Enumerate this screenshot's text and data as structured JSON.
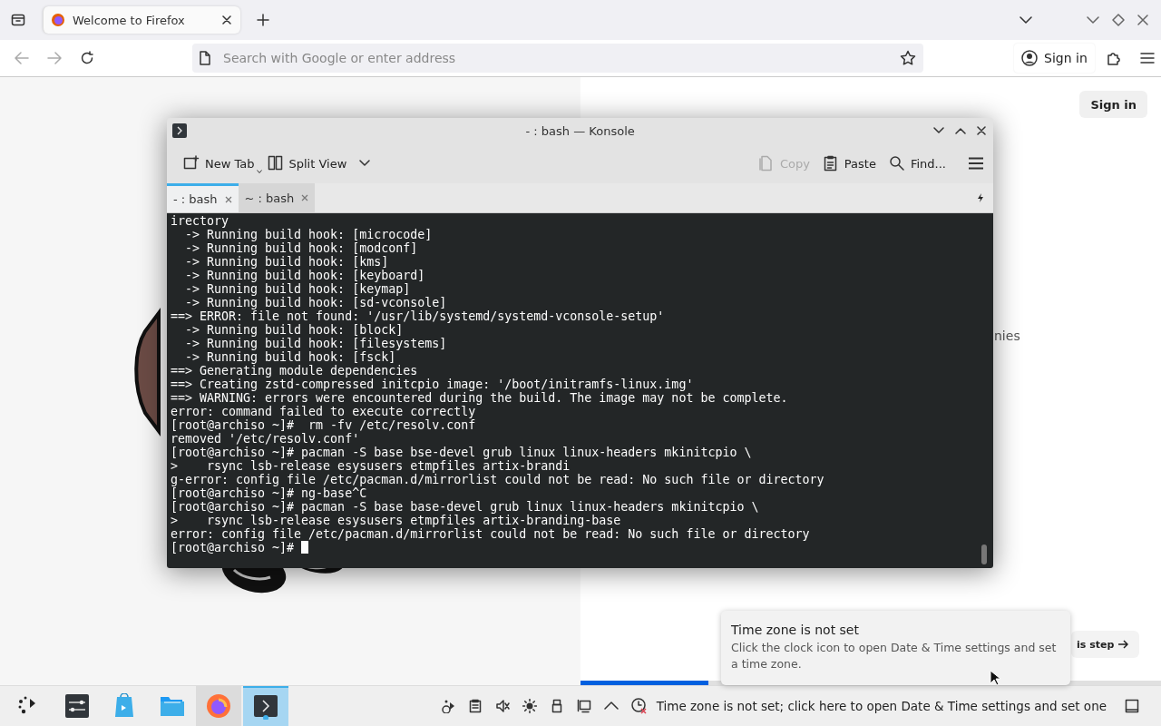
{
  "browser": {
    "tabs": [
      {
        "title": "Welcome to Firefox",
        "selected": true
      }
    ],
    "address_bar": {
      "placeholder": "Search with Google or enter address"
    },
    "sign_in_button": "Sign in"
  },
  "page": {
    "sign_in_button": "Sign in",
    "text_fragment": "nies",
    "skip_button": "is step",
    "progress": {
      "level": 0.22
    }
  },
  "konsole": {
    "title": "- : bash — Konsole",
    "toolbar": [
      {
        "kind": "newtab",
        "label": "New Tab",
        "disabled": false
      },
      {
        "kind": "split",
        "label": "Split View",
        "disabled": false
      },
      {
        "kind": "copy",
        "label": "Copy",
        "disabled": true
      },
      {
        "kind": "paste",
        "label": "Paste",
        "disabled": false
      },
      {
        "kind": "find",
        "label": "Find...",
        "disabled": false
      }
    ],
    "tabs": [
      {
        "title": "- : bash",
        "selected": true
      },
      {
        "title": "~ : bash",
        "selected": false
      }
    ],
    "lines": [
      "irectory",
      "  -> Running build hook: [microcode]",
      "  -> Running build hook: [modconf]",
      "  -> Running build hook: [kms]",
      "  -> Running build hook: [keyboard]",
      "  -> Running build hook: [keymap]",
      "  -> Running build hook: [sd-vconsole]",
      "==> ERROR: file not found: '/usr/lib/systemd/systemd-vconsole-setup'",
      "  -> Running build hook: [block]",
      "  -> Running build hook: [filesystems]",
      "  -> Running build hook: [fsck]",
      "==> Generating module dependencies",
      "==> Creating zstd-compressed initcpio image: '/boot/initramfs-linux.img'",
      "==> WARNING: errors were encountered during the build. The image may not be complete.",
      "error: command failed to execute correctly",
      "[root@archiso ~]#  rm -fv /etc/resolv.conf",
      "removed '/etc/resolv.conf'",
      "[root@archiso ~]# pacman -S base bse-devel grub linux linux-headers mkinitcpio \\",
      ">    rsync lsb-release esysusers etmpfiles artix-brandi",
      "g-error: config file /etc/pacman.d/mirrorlist could not be read: No such file or directory",
      "[root@archiso ~]# ng-base^C",
      "[root@archiso ~]# pacman -S base base-devel grub linux linux-headers mkinitcpio \\",
      ">    rsync lsb-release esysusers etmpfiles artix-branding-base",
      "error: config file /etc/pacman.d/mirrorlist could not be read: No such file or directory",
      "[root@archiso ~]# "
    ]
  },
  "taskbar": {
    "apps": [
      {
        "kind": "launcher",
        "open": false,
        "selected": false
      },
      {
        "kind": "settings",
        "open": false,
        "selected": false
      },
      {
        "kind": "discover",
        "open": false,
        "selected": false
      },
      {
        "kind": "files",
        "open": false,
        "selected": false
      },
      {
        "kind": "firefox",
        "open": true,
        "selected": false
      },
      {
        "kind": "konsole",
        "open": true,
        "selected": true
      }
    ],
    "tray_notice": "Time zone is not set; click here to open Date & Time settings and set one"
  },
  "notification": {
    "title": "Time zone is not set",
    "body": "Click the clock icon to open Date & Time settings and set a time zone."
  }
}
